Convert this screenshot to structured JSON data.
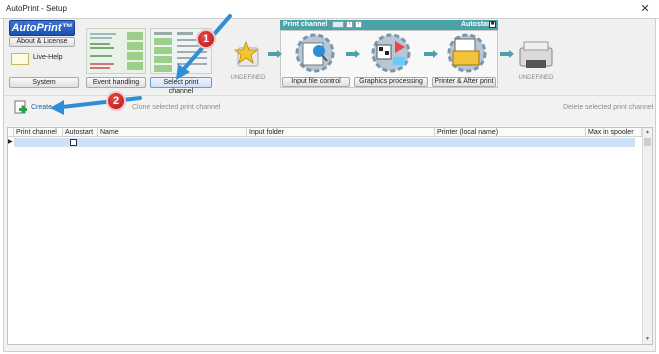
{
  "window": {
    "title": "AutoPrint - Setup",
    "close_glyph": "✕"
  },
  "logo": {
    "text": "AutoPrint™"
  },
  "left_buttons": {
    "about": "About & License",
    "live_help": "Live-Help",
    "system": "System"
  },
  "top_buttons": {
    "event_handling": "Event handling",
    "select_print_channel": "Select print channel"
  },
  "undefined_label": "UNDEFINED",
  "print_channel_panel": {
    "title": "Print channel",
    "autostart": "Autostart",
    "steps": [
      "Input file control",
      "Graphics processing",
      "Printer & After print"
    ]
  },
  "undefined_right": "UNDEFINED",
  "actions": {
    "create": "Create n",
    "clone": "Clone selected print channel",
    "delete": "Delete selected print channel"
  },
  "grid": {
    "columns": [
      "Print channel",
      "Autostart",
      "Name",
      "Input folder",
      "Printer (local name)",
      "Max in spooler"
    ],
    "rows": [
      {
        "print_channel": "",
        "autostart": false,
        "name": "",
        "input_folder": "",
        "printer": "",
        "max_in_spooler": ""
      }
    ]
  },
  "annotations": {
    "badge1": "1",
    "badge2": "2"
  },
  "colors": {
    "teal": "#49a3a8",
    "accent_blue": "#2f8fd6",
    "badge_red": "#c41f1f"
  }
}
